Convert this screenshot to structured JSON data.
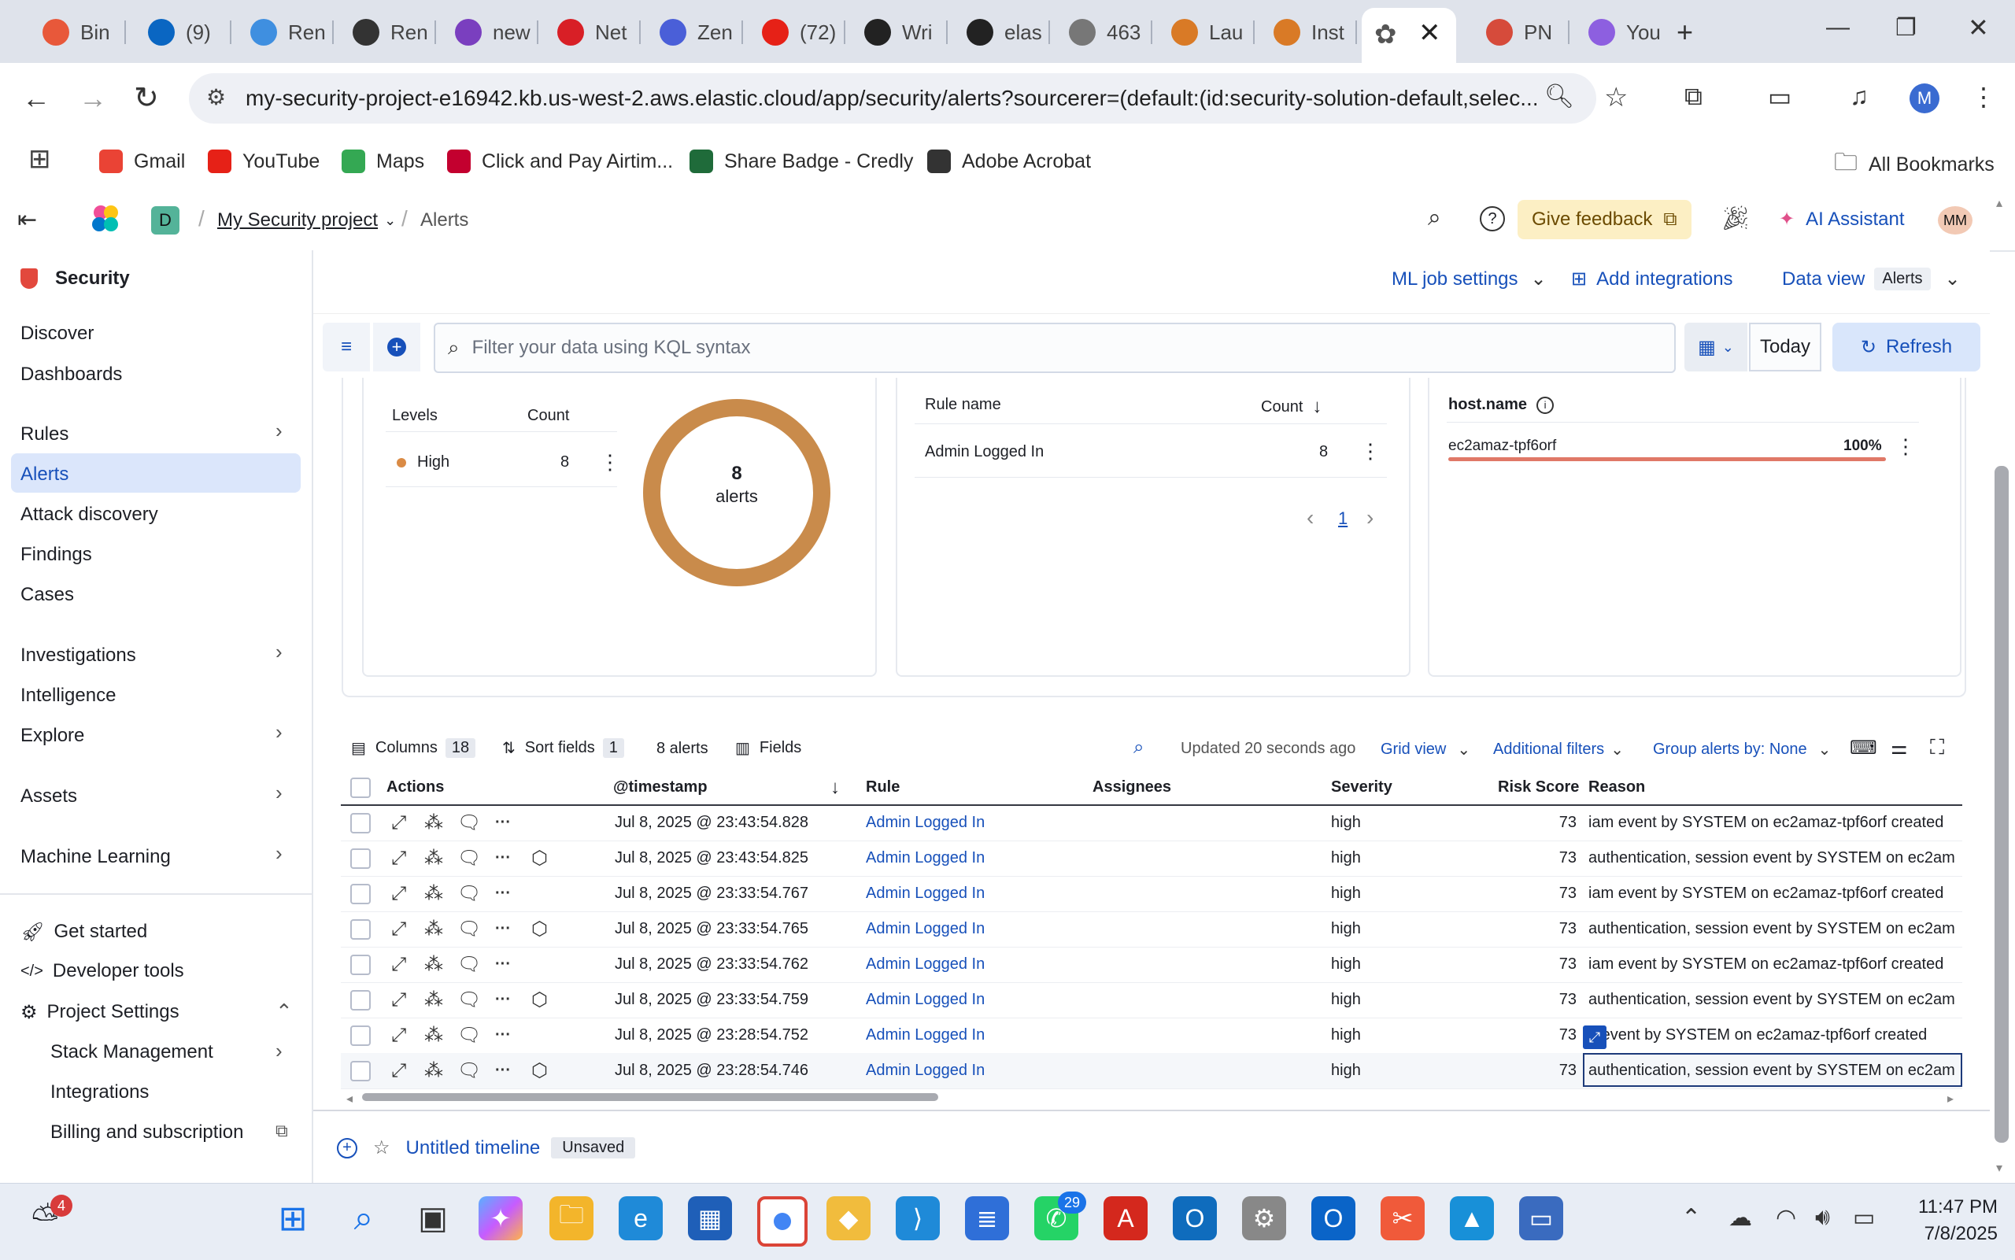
{
  "browser": {
    "tabs": [
      {
        "label": "Bin",
        "icon": "brave-icon",
        "color": "#e8583a"
      },
      {
        "label": "(9)",
        "icon": "linkedin-icon",
        "color": "#0a66c2"
      },
      {
        "label": "Ren",
        "icon": "le-icon",
        "color": "#3f8fe0"
      },
      {
        "label": "Ren",
        "icon": "people-icon",
        "color": "#333333"
      },
      {
        "label": "new",
        "icon": "peace-icon",
        "color": "#7a3fbf"
      },
      {
        "label": "Net",
        "icon": "netflix-icon",
        "color": "#d81f26"
      },
      {
        "label": "Zen",
        "icon": "zen-icon",
        "color": "#4a5fd8"
      },
      {
        "label": "(72)",
        "icon": "youtube-icon",
        "color": "#e62117"
      },
      {
        "label": "Wri",
        "icon": "github-icon",
        "color": "#222222"
      },
      {
        "label": "elas",
        "icon": "github-icon",
        "color": "#222222"
      },
      {
        "label": "463",
        "icon": "globe-icon",
        "color": "#777777"
      },
      {
        "label": "Lau",
        "icon": "aws-icon",
        "color": "#d97a26"
      },
      {
        "label": "Inst",
        "icon": "aws-icon",
        "color": "#d97a26"
      },
      {
        "label": "",
        "icon": "elastic-icon",
        "color": "#555555"
      },
      {
        "label": "PN",
        "icon": "pngjpg-icon",
        "color": "#d64b3b"
      },
      {
        "label": "You",
        "icon": "purple-icon",
        "color": "#8d5fe0"
      }
    ],
    "new_tab_label": "+",
    "url": "my-security-project-e16942.kb.us-west-2.aws.elastic.cloud/app/security/alerts?sourcerer=(default:(id:security-solution-default,selec...",
    "profile_initial": "M",
    "bookmarks": [
      {
        "label": "Gmail",
        "icon": "gmail-icon",
        "color": "#ea4335"
      },
      {
        "label": "YouTube",
        "icon": "youtube-icon",
        "color": "#e62117"
      },
      {
        "label": "Maps",
        "icon": "maps-icon",
        "color": "#34a853"
      },
      {
        "label": "Click and Pay Airtim...",
        "icon": "angular-icon",
        "color": "#c3002f"
      },
      {
        "label": "Share Badge - Credly",
        "icon": "credly-icon",
        "color": "#1f6b3a"
      },
      {
        "label": "Adobe Acrobat",
        "icon": "acrobat-icon",
        "color": "#333333"
      }
    ],
    "all_bookmarks": "All Bookmarks"
  },
  "header": {
    "space_initial": "D",
    "project": "My Security project",
    "page": "Alerts",
    "feedback": "Give feedback",
    "ai_assistant": "AI Assistant",
    "user_initials": "MM"
  },
  "sidebar": {
    "app_title": "Security",
    "items": [
      {
        "label": "Discover",
        "chevron": false
      },
      {
        "label": "Dashboards",
        "chevron": false
      },
      {
        "label": "Rules",
        "chevron": true
      },
      {
        "label": "Alerts",
        "chevron": false,
        "active": true
      },
      {
        "label": "Attack discovery",
        "chevron": false
      },
      {
        "label": "Findings",
        "chevron": false
      },
      {
        "label": "Cases",
        "chevron": false
      },
      {
        "label": "Investigations",
        "chevron": true
      },
      {
        "label": "Intelligence",
        "chevron": false
      },
      {
        "label": "Explore",
        "chevron": true
      },
      {
        "label": "Assets",
        "chevron": true
      },
      {
        "label": "Machine Learning",
        "chevron": true
      }
    ],
    "footer": {
      "get_started": "Get started",
      "developer_tools": "Developer tools",
      "project_settings": "Project Settings",
      "stack_management": "Stack Management",
      "integrations": "Integrations",
      "billing": "Billing and subscription"
    }
  },
  "toolbar": {
    "ml_job_settings": "ML job settings",
    "add_integrations": "Add integrations",
    "data_view_label": "Data view",
    "data_view_value": "Alerts",
    "search_placeholder": "Filter your data using KQL syntax",
    "date_label": "Today",
    "refresh": "Refresh"
  },
  "severity_panel": {
    "col_levels": "Levels",
    "col_count": "Count",
    "level": "High",
    "count": "8",
    "donut_value": "8",
    "donut_label": "alerts",
    "donut_color": "#c98b4b"
  },
  "rule_panel": {
    "col_rule": "Rule name",
    "col_count": "Count",
    "rule": "Admin Logged In",
    "count": "8",
    "page": "1"
  },
  "host_panel": {
    "col_host": "host.name",
    "host": "ec2amaz-tpf6orf",
    "percent": "100%",
    "fill_fraction": 1.0,
    "bar_color": "#e07867"
  },
  "grid_toolbar": {
    "columns_label": "Columns",
    "columns_count": "18",
    "sort_label": "Sort fields",
    "sort_count": "1",
    "alerts_count": "8 alerts",
    "fields": "Fields",
    "updated": "Updated 20 seconds ago",
    "grid_view": "Grid view",
    "additional_filters": "Additional filters",
    "group_by": "Group alerts by: None"
  },
  "table": {
    "headers": {
      "actions": "Actions",
      "timestamp": "@timestamp",
      "rule": "Rule",
      "assignees": "Assignees",
      "severity": "Severity",
      "risk": "Risk Score",
      "reason": "Reason"
    },
    "rows": [
      {
        "timestamp": "Jul 8, 2025 @ 23:43:54.828",
        "rule": "Admin Logged In",
        "severity": "high",
        "risk": "73",
        "reason": "iam event by SYSTEM on ec2amaz-tpf6orf created",
        "cube": false
      },
      {
        "timestamp": "Jul 8, 2025 @ 23:43:54.825",
        "rule": "Admin Logged In",
        "severity": "high",
        "risk": "73",
        "reason": "authentication, session event by SYSTEM on ec2am",
        "cube": true
      },
      {
        "timestamp": "Jul 8, 2025 @ 23:33:54.767",
        "rule": "Admin Logged In",
        "severity": "high",
        "risk": "73",
        "reason": "iam event by SYSTEM on ec2amaz-tpf6orf created",
        "cube": false
      },
      {
        "timestamp": "Jul 8, 2025 @ 23:33:54.765",
        "rule": "Admin Logged In",
        "severity": "high",
        "risk": "73",
        "reason": "authentication, session event by SYSTEM on ec2am",
        "cube": true
      },
      {
        "timestamp": "Jul 8, 2025 @ 23:33:54.762",
        "rule": "Admin Logged In",
        "severity": "high",
        "risk": "73",
        "reason": "iam event by SYSTEM on ec2amaz-tpf6orf created",
        "cube": false
      },
      {
        "timestamp": "Jul 8, 2025 @ 23:33:54.759",
        "rule": "Admin Logged In",
        "severity": "high",
        "risk": "73",
        "reason": "authentication, session event by SYSTEM on ec2am",
        "cube": true
      },
      {
        "timestamp": "Jul 8, 2025 @ 23:28:54.752",
        "rule": "Admin Logged In",
        "severity": "high",
        "risk": "73",
        "reason": "n event by SYSTEM on ec2amaz-tpf6orf created",
        "cube": false
      },
      {
        "timestamp": "Jul 8, 2025 @ 23:28:54.746",
        "rule": "Admin Logged In",
        "severity": "high",
        "risk": "73",
        "reason": "authentication, session event by SYSTEM on ec2am",
        "cube": true
      }
    ]
  },
  "timeline": {
    "title": "Untitled timeline",
    "status": "Unsaved"
  },
  "taskbar": {
    "weather_badge": "4",
    "whatsapp_badge": "29",
    "time": "11:47 PM",
    "date": "7/8/2025"
  }
}
